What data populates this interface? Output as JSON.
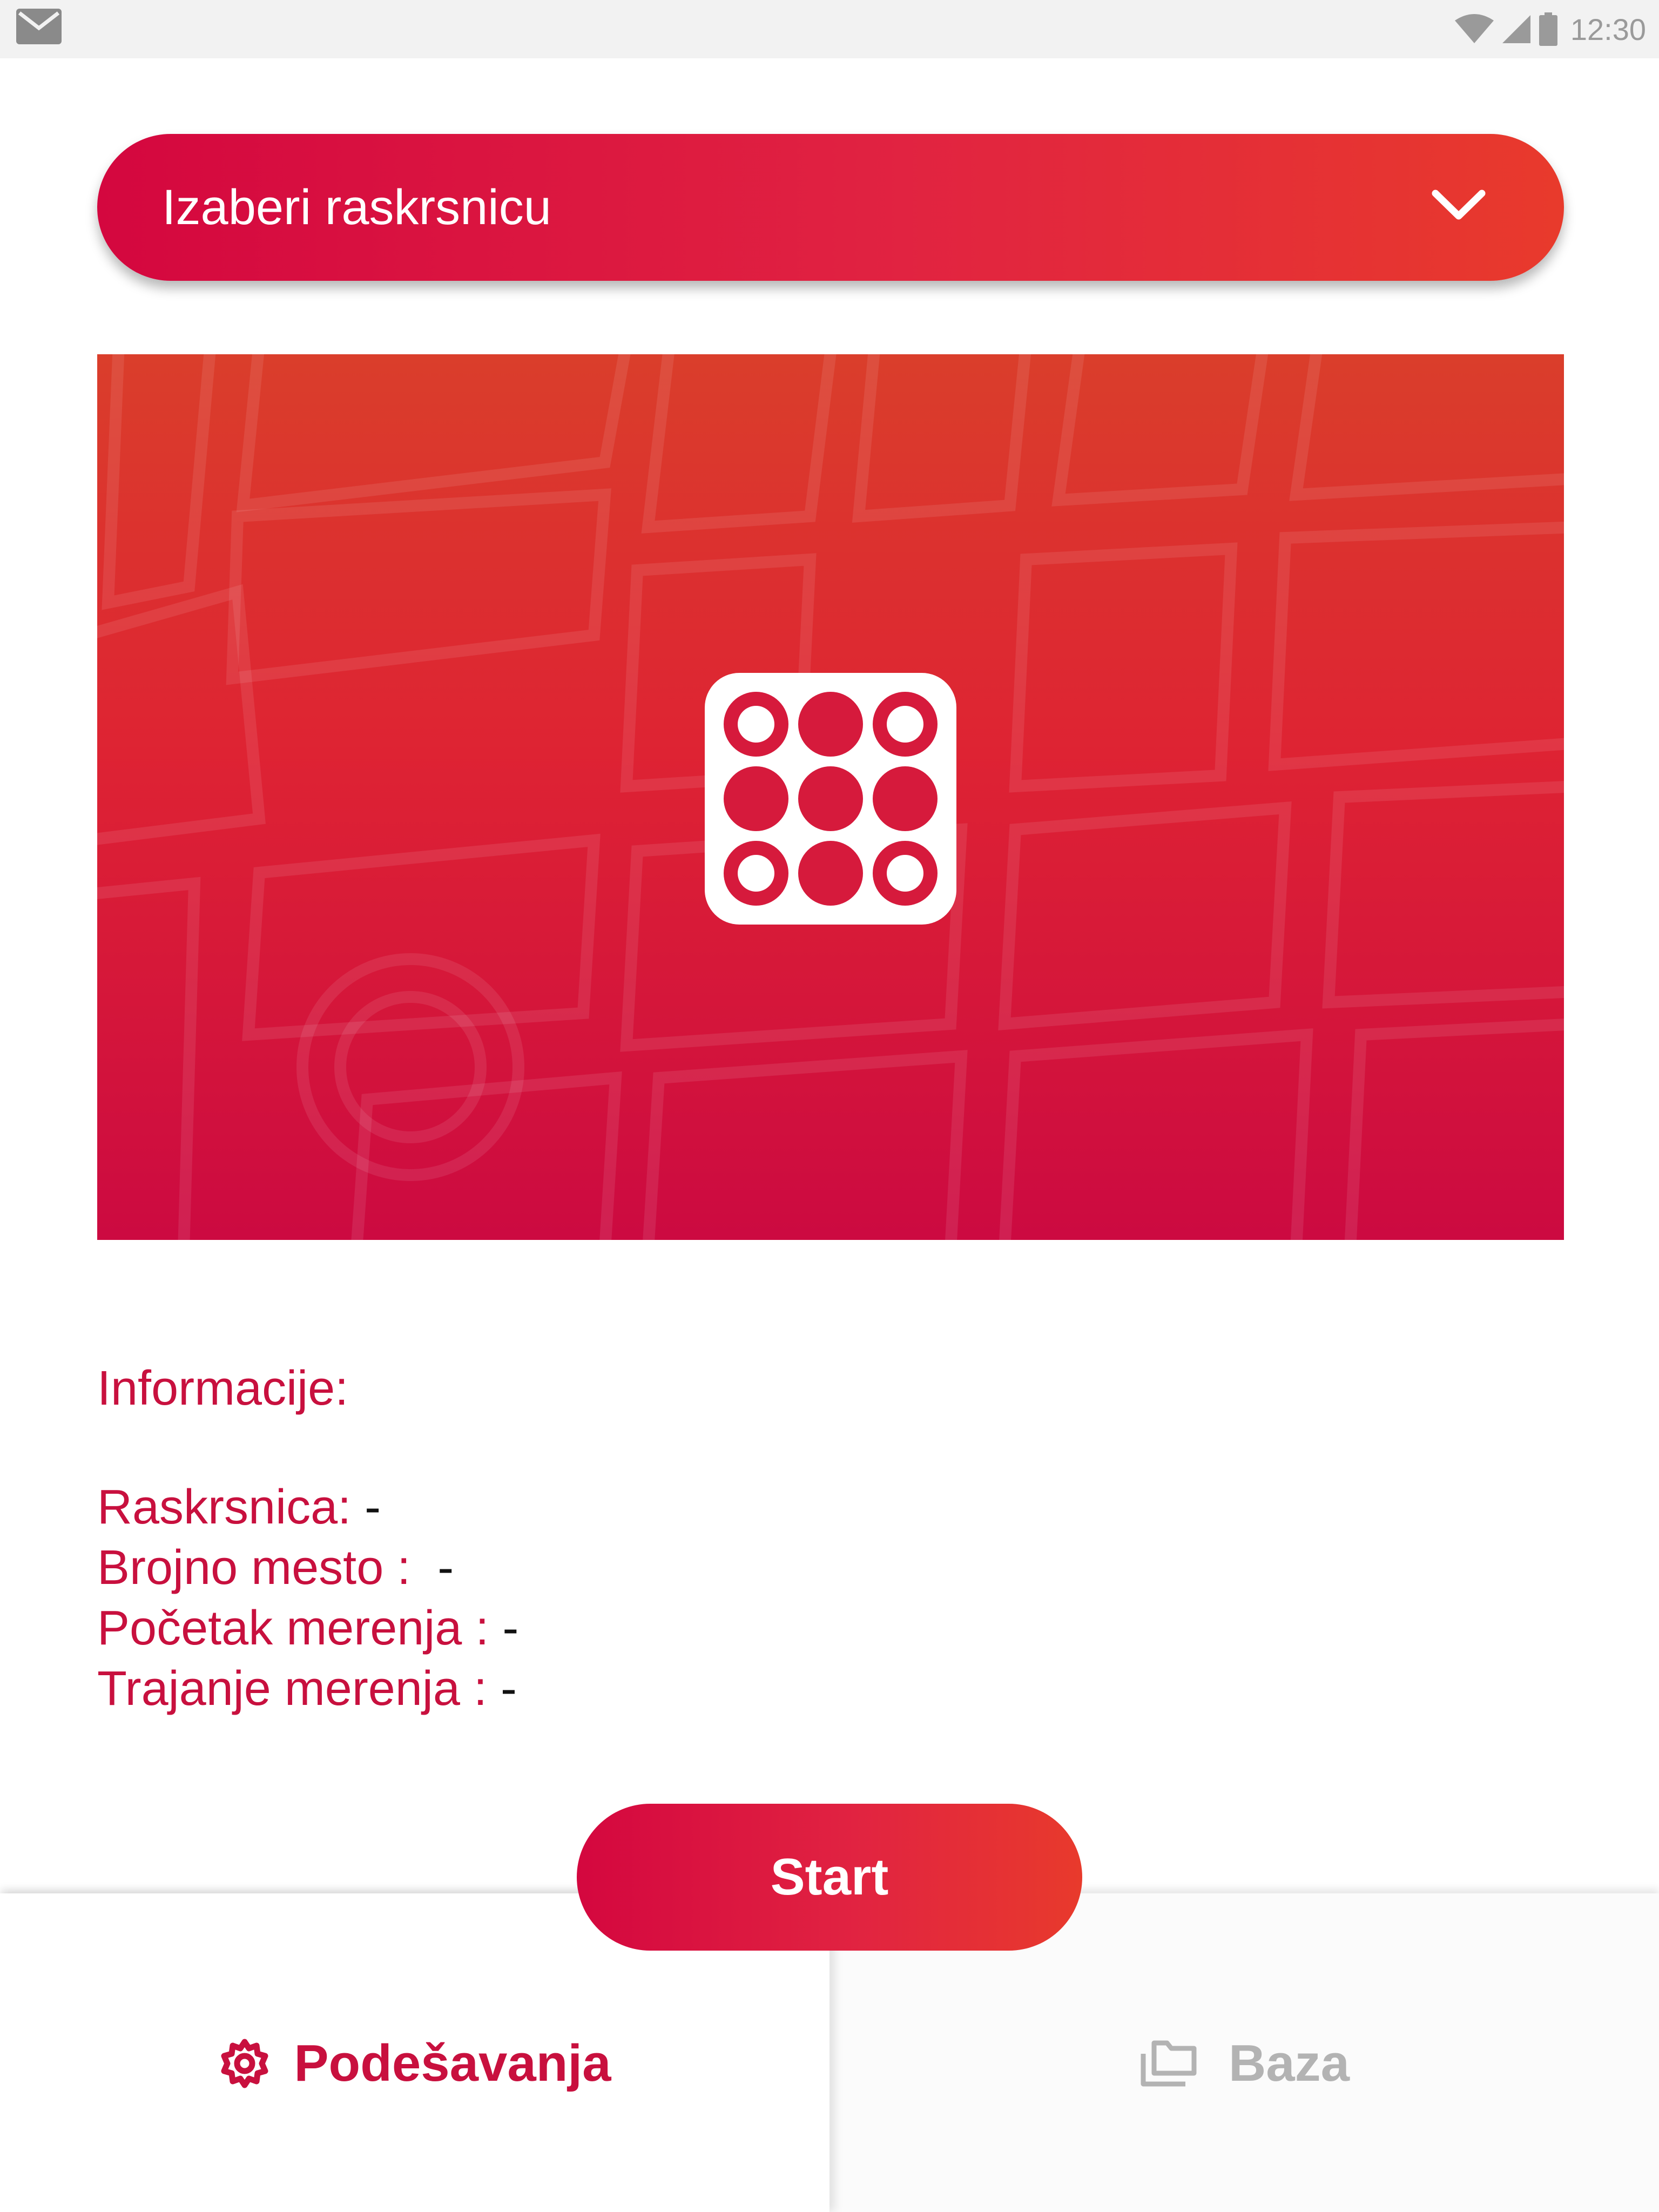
{
  "status_bar": {
    "time": "12:30",
    "icons": [
      "mail-icon",
      "wifi-icon",
      "signal-icon",
      "battery-icon"
    ]
  },
  "dropdown": {
    "label": "Izaberi raskrsnicu",
    "icon": "chevron-down-icon"
  },
  "hero": {
    "logo_icon": "dots-grid-logo-icon"
  },
  "info": {
    "title": "Informacije:",
    "rows": [
      {
        "label": "Raskrsnica:",
        "value": " -"
      },
      {
        "label": "Brojno mesto : ",
        "value": " -"
      },
      {
        "label": "Početak merenja :",
        "value": " -"
      },
      {
        "label": "Trajanje merenja :",
        "value": " -"
      }
    ]
  },
  "start_button": {
    "label": "Start"
  },
  "bottom_nav": {
    "tabs": [
      {
        "label": "Podešavanja",
        "icon": "gear-icon",
        "active": true
      },
      {
        "label": "Baza",
        "icon": "folders-icon",
        "active": false
      }
    ]
  },
  "colors": {
    "accent": "#c8103e",
    "gradient_start": "#d4073f",
    "gradient_end": "#e83a2c",
    "inactive": "#b3b3b3"
  }
}
